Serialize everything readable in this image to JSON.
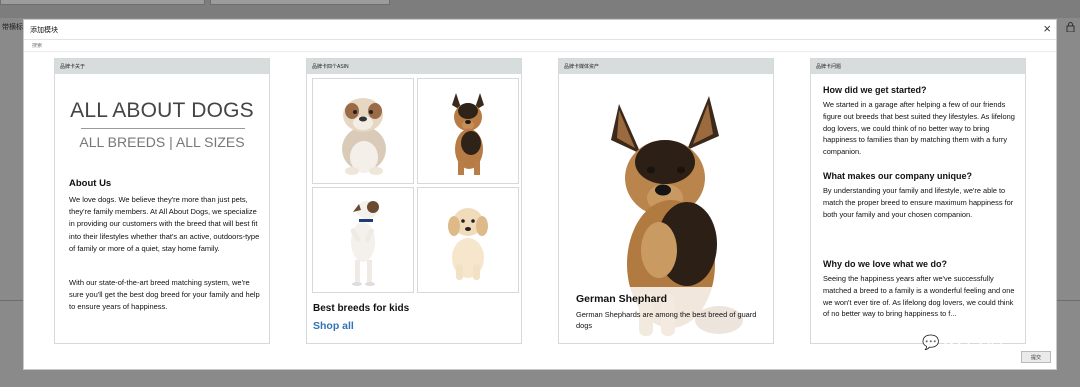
{
  "background": {
    "left_label": "带横标志",
    "lock_icon": "lock-icon"
  },
  "modal": {
    "title": "添加模块",
    "search_placeholder": "搜索",
    "confirm_label": "提交"
  },
  "cards": [
    {
      "header": "品牌卡关于",
      "big_title": "ALL ABOUT DOGS",
      "sub_title": "ALL BREEDS | ALL SIZES",
      "about_heading": "About Us",
      "about_p1": "We love dogs. We believe they're more than just pets, they're family members. At All About Dogs, we specialize in providing our customers with the breed that will best fit into their lifestyles whether that's an active, outdoors-type of family or more of a quiet, stay home family.",
      "about_p2": "With our state-of-the-art breed matching system, we're sure you'll get the best dog breed for your family and help to ensure years of happiness."
    },
    {
      "header": "品牌卡四个ASIN",
      "caption": "Best breeds for kids",
      "link": "Shop all"
    },
    {
      "header": "品牌卡媒体资产",
      "title": "German Shephard",
      "text": "German Shephards are among the best breed of guard dogs"
    },
    {
      "header": "品牌卡问题",
      "q1": "How did we get started?",
      "a1": "We started in a garage after helping a few of our friends figure out breeds that best suited they lifestyles. As lifelong dog lovers, we could think of no better way to bring happiness to families than by matching them with a furry companion.",
      "q2": "What makes our company unique?",
      "a2": "By understanding your family and lifestyle, we're able to match the proper breed to ensure maximum happiness for both your family and your chosen companion.",
      "q3": "Why do we love what we do?",
      "a3": "Seeing the happiness years after we've successfully matched a breed to a family is a wonderful feeling and one we won't ever tire of. As lifelong dog lovers, we could think of no better way to bring happiness to f..."
    }
  ],
  "watermark": "Kris浩"
}
